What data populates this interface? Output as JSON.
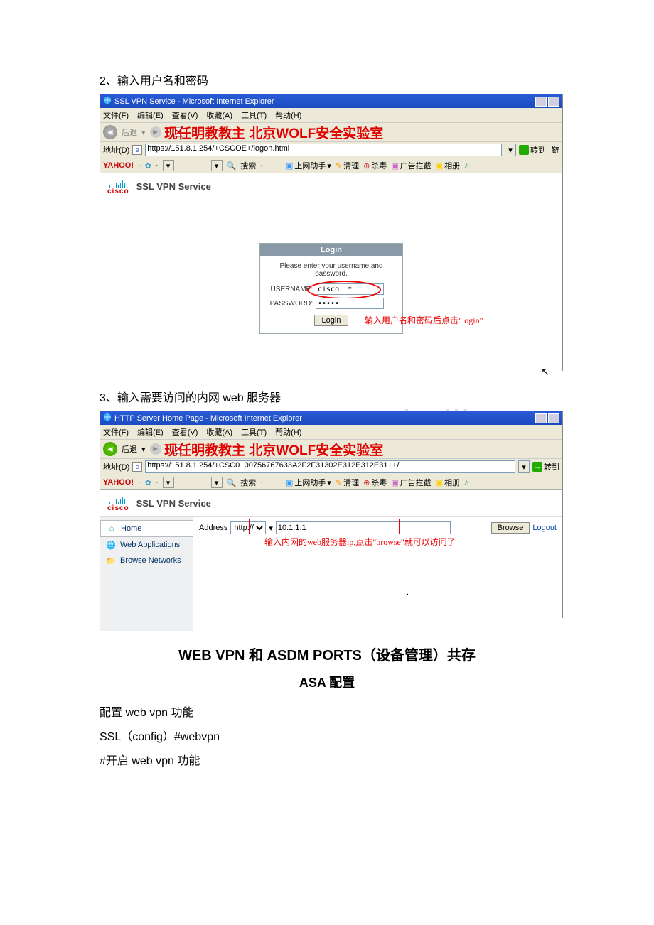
{
  "step2_label": "2、输入用户名和密码",
  "step3_label": "3、输入需要访问的内网 web 服务器",
  "watermark_text": "现任明教教主 北京WOLF安全实验室",
  "ghost_watermark": "mbalib.com",
  "window1": {
    "title": "SSL VPN Service - Microsoft Internet Explorer",
    "menus": [
      "文件(F)",
      "编辑(E)",
      "查看(V)",
      "收藏(A)",
      "工具(T)",
      "帮助(H)"
    ],
    "nav_back": "后退",
    "addr_label": "地址(D)",
    "addr_value": "https://151.8.1.254/+CSCOE+/logon.html",
    "go_label": "转到",
    "links_label": "链",
    "yahoo_logo": "YAHOO!",
    "yahoo_search": "搜索",
    "toolbar_items": [
      "上网助手",
      "清理",
      "杀毒",
      "广告拦截",
      "相册"
    ],
    "cisco_text": "cisco",
    "ssl_service": "SSL VPN Service",
    "login_header": "Login",
    "login_prompt": "Please enter your username and password.",
    "username_label": "USERNAME:",
    "username_value": "cisco  *",
    "password_label": "PASSWORD:",
    "password_value": "•••••",
    "login_button": "Login",
    "annot_login": "输入用户名和密码后点击\"login\""
  },
  "window2": {
    "title": "HTTP Server Home Page - Microsoft Internet Explorer",
    "menus": [
      "文件(F)",
      "编辑(E)",
      "查看(V)",
      "收藏(A)",
      "工具(T)",
      "帮助(H)"
    ],
    "nav_back": "后退",
    "addr_label": "地址(D)",
    "addr_value": "https://151.8.1.254/+CSC0+00756767633A2F2F31302E312E312E31++/",
    "go_label": "转到",
    "yahoo_logo": "YAHOO!",
    "yahoo_search": "搜索",
    "toolbar_items": [
      "上网助手",
      "清理",
      "杀毒",
      "广告拦截",
      "相册"
    ],
    "cisco_text": "cisco",
    "ssl_service": "SSL VPN Service",
    "side_home": "Home",
    "side_webapps": "Web Applications",
    "side_browse": "Browse Networks",
    "address_label": "Address",
    "scheme_value": "http://",
    "ip_value": "10.1.1.1",
    "browse_label": "Browse",
    "logout_label": "Logout",
    "annot_browse": "输入内网的web服务器ip,点击\"browse\"就可以访问了"
  },
  "doc": {
    "title": "WEB VPN 和 ASDM PORTS（设备管理）共存",
    "subtitle": "ASA 配置",
    "line1": "配置 web vpn 功能",
    "line2": "SSL（config）#webvpn",
    "line3": "#开启 web vpn 功能"
  }
}
